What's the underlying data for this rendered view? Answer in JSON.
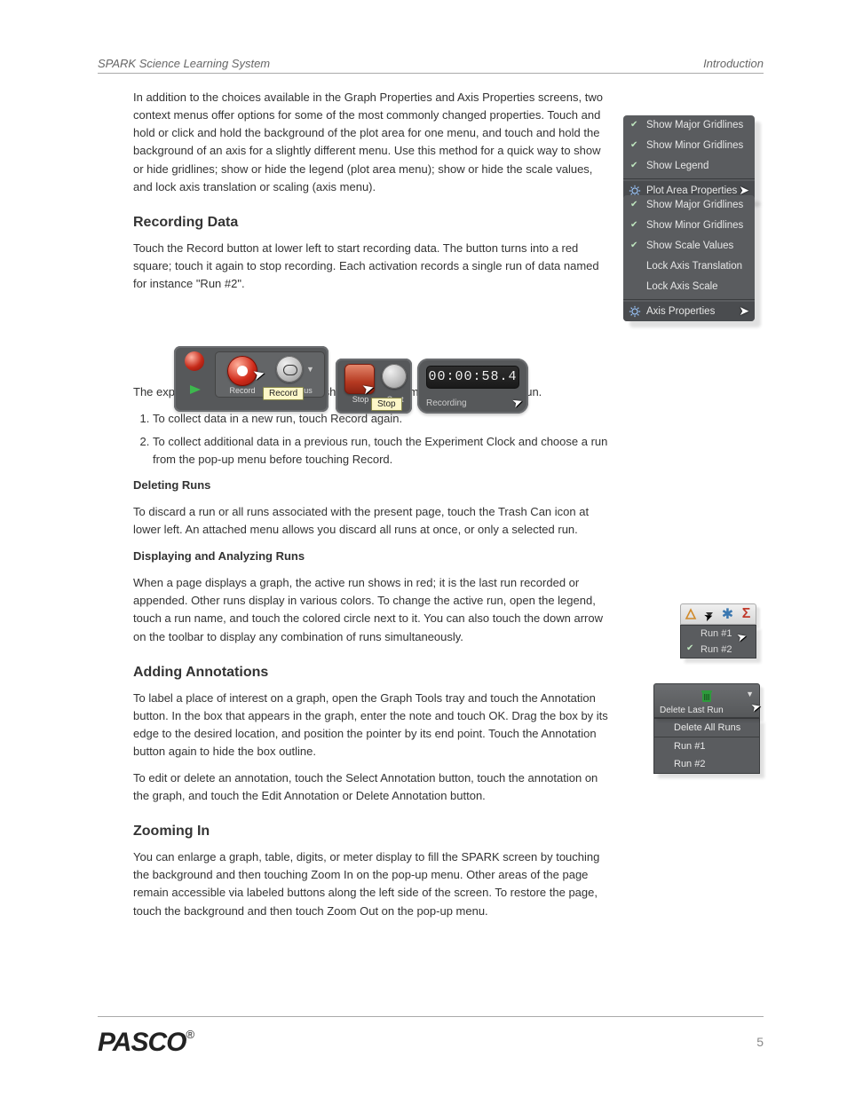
{
  "header": {
    "left": "SPARK Science Learning System",
    "right": "Introduction"
  },
  "intro": "In addition to the choices available in the Graph Properties and Axis Properties screens, two context menus offer options for some of the most commonly changed properties. Touch and hold or click and hold the background of the plot area for one menu, and touch and hold the background of an axis for a slightly different menu. Use this method for a quick way to show or hide gridlines; show or hide the legend (plot area menu); show or hide the scale values, and lock axis translation or scaling (axis menu).",
  "section_recording": {
    "title": "Recording Data",
    "lead": "Touch the Record button at lower left to start recording data. The button turns into a red square; touch it again to stop recording. Each activation records a single run of data named for instance \"Run #2\".",
    "timer_note": "The experiment clock (shown below) shows elapsed time during and after a run.",
    "step1": "To collect data in a new run, touch Record again.",
    "step2": "To collect additional data in a previous run, touch the Experiment Clock and choose a run from the pop-up menu before touching Record.",
    "deleting_title": "Deleting Runs",
    "deleting_text": "To discard a run or all runs associated with the present page, touch the Trash Can icon at lower left. An attached menu allows you discard all runs at once, or only a selected run.",
    "displaying_title": "Displaying and Analyzing Runs",
    "displaying_text": "When a page displays a graph, the active run shows in red; it is the last run recorded or appended. Other runs display in various colors. To change the active run, open the legend, touch a run name, and touch the colored circle next to it. You can also touch the down arrow on the toolbar to display any combination of runs simultaneously."
  },
  "section_annotations": {
    "title": "Adding Annotations",
    "text": "To label a place of interest on a graph, open the Graph Tools tray and touch the Annotation button. In the box that appears in the graph, enter the note and touch OK. Drag the box by its edge to the desired location, and position the pointer by its end point. Touch the Annotation button again to hide the box outline.",
    "text2": "To edit or delete an annotation, touch the Select Annotation button, touch the annotation on the graph, and touch the Edit Annotation or Delete Annotation button."
  },
  "section_zoom": {
    "title": "Zooming In",
    "text": "You can enlarge a graph, table, digits, or meter display to fill the SPARK screen by touching the background and then touching Zoom In on the pop-up menu. Other areas of the page remain accessible via labeled buttons along the left side of the screen. To restore the page, touch the background and then touch Zoom Out on the pop-up menu."
  },
  "plot_menu": {
    "items": [
      "Show Major Gridlines",
      "Show Minor Gridlines",
      "Show Legend"
    ],
    "footer": "Plot Area Properties"
  },
  "axis_menu": {
    "items": [
      "Show Major Gridlines",
      "Show Minor Gridlines",
      "Show Scale Values",
      "Lock Axis Translation",
      "Lock Axis Scale"
    ],
    "footer": "Axis Properties"
  },
  "toolbar": {
    "record_label": "Record",
    "continuous_label": "Continuous",
    "record_tooltip": "Record",
    "stop_label": "Stop",
    "cont2_label": "Cont",
    "stop_tooltip": "Stop",
    "timer_value": "00:00:58.4",
    "timer_status": "Recording"
  },
  "run_chooser": {
    "items": [
      "Run #1",
      "Run #2"
    ]
  },
  "delete_popup": {
    "button": "Delete Last Run",
    "items": [
      "Delete All Runs",
      "Run #1",
      "Run #2"
    ]
  },
  "footer": {
    "logo": "PASCO",
    "reg": "®",
    "page": "5"
  }
}
